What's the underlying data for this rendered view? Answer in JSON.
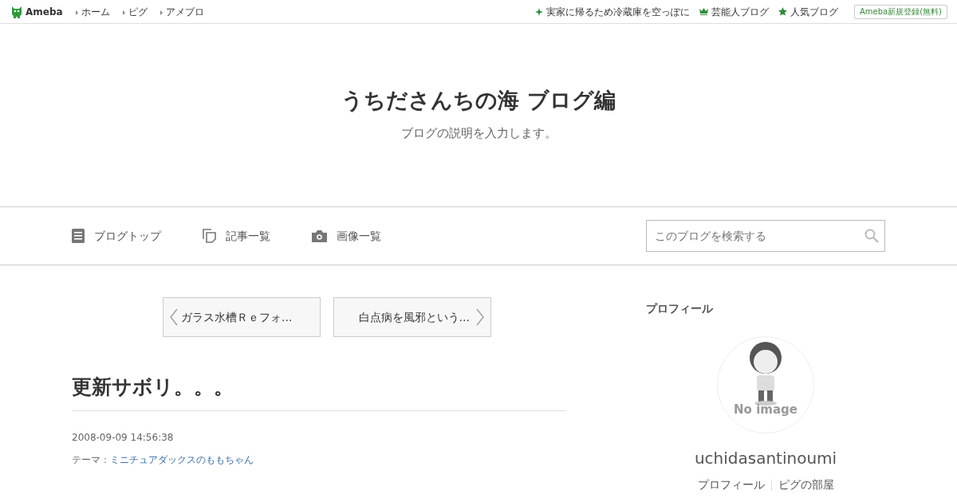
{
  "global_bar": {
    "logo": "Ameba",
    "links": [
      "ホーム",
      "ピグ",
      "アメブロ"
    ],
    "right_links": [
      {
        "kind": "sparkle",
        "label": "実家に帰るため冷蔵庫を空っぽに"
      },
      {
        "kind": "crown",
        "label": "芸能人ブログ"
      },
      {
        "kind": "star",
        "label": "人気ブログ"
      }
    ],
    "register_button": "Ameba新規登録(無料)"
  },
  "blog": {
    "title": "うちださんちの海 ブログ編",
    "description": "ブログの説明を入力します。"
  },
  "nav": {
    "items": [
      {
        "kind": "top",
        "label": "ブログトップ"
      },
      {
        "kind": "list",
        "label": "記事一覧"
      },
      {
        "kind": "images",
        "label": "画像一覧"
      }
    ],
    "search": {
      "placeholder": "このブログを検索する"
    }
  },
  "pager": {
    "prev": "ガラス水槽Ｒｅフォ…",
    "next": "白点病を風邪という…"
  },
  "article": {
    "title": "更新サボリ。。。",
    "datetime": "2008-09-09 14:56:38",
    "theme_label": "テーマ：",
    "theme": "ミニチュアダックスのももちゃん"
  },
  "profile": {
    "heading": "プロフィール",
    "avatar_caption": "No image",
    "username": "uchidasantinoumi",
    "links": [
      "プロフィール",
      "ピグの部屋"
    ]
  }
}
